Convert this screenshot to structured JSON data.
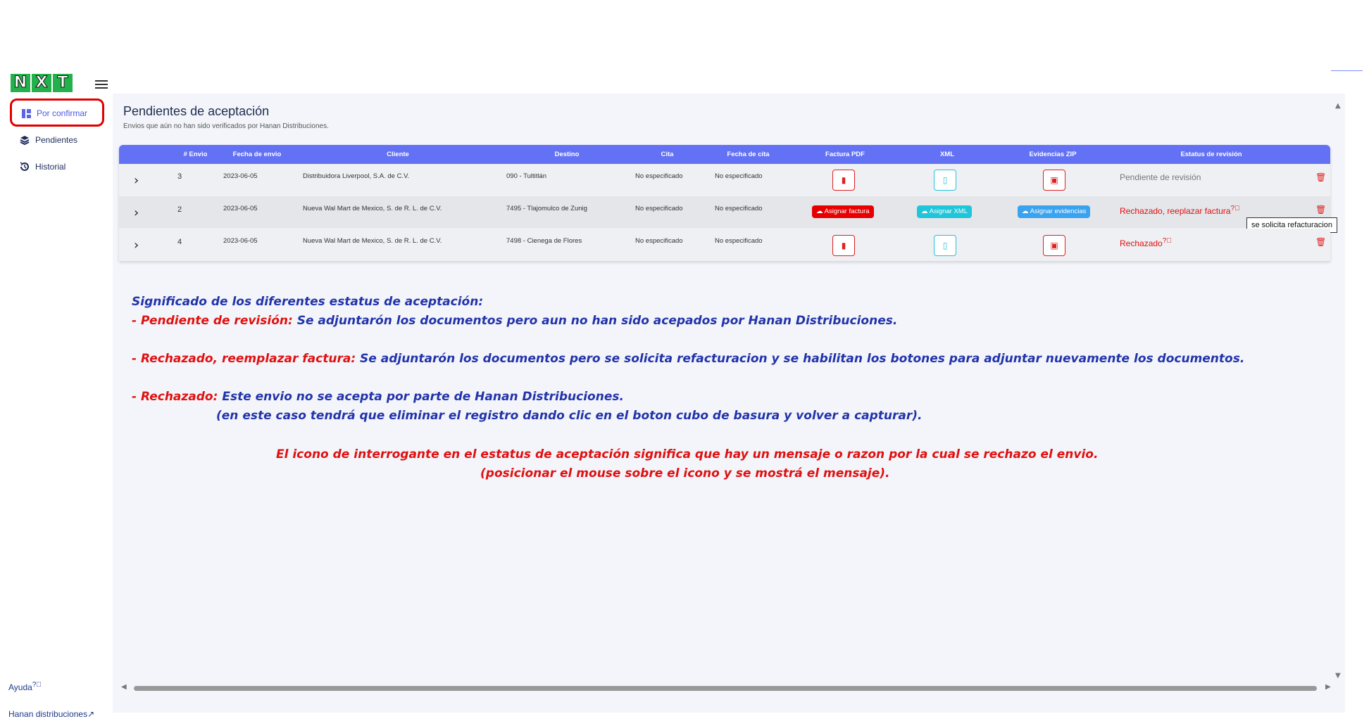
{
  "logo": {
    "letters": [
      "N",
      "X",
      "T"
    ],
    "colors": [
      "#22b14c",
      "#22b14c",
      "#22b14c"
    ]
  },
  "sidebar": {
    "items": [
      {
        "label": "Por confirmar",
        "icon": "dashboard-icon",
        "active": true
      },
      {
        "label": "Pendientes",
        "icon": "layers-icon"
      },
      {
        "label": "Historial",
        "icon": "history-icon"
      }
    ],
    "help": "Ayuda",
    "company_link": "Hanan distribuciones"
  },
  "page": {
    "title": "Pendientes de aceptación",
    "subtitle": "Envios que aún no han sido verificados por Hanan Distribuciones."
  },
  "table": {
    "headers": [
      "# Envio",
      "Fecha de envio",
      "Cliente",
      "Destino",
      "Cita",
      "Fecha de cita",
      "Factura PDF",
      "XML",
      "Evidencias ZIP",
      "Estatus de revisión"
    ],
    "rows": [
      {
        "envio": "3",
        "fecha": "2023-06-05",
        "cliente": "Distribuidora Liverpool, S.A. de C.V.",
        "destino": "090 - Tultitlán",
        "cita": "No especificado",
        "fecha_cita": "No especificado",
        "status": "Pendiente de revisión"
      },
      {
        "envio": "2",
        "fecha": "2023-06-05",
        "cliente": "Nueva Wal Mart de Mexico, S. de R. L. de C.V.",
        "destino": "7495 - Tlajomulco de Zunig",
        "cita": "No especificado",
        "fecha_cita": "No especificado",
        "status": "Rechazado, reeplazar factura",
        "btn_factura": "Asignar factura",
        "btn_xml": "Asignar XML",
        "btn_evid": "Asignar evidencias"
      },
      {
        "envio": "4",
        "fecha": "2023-06-05",
        "cliente": "Nueva Wal Mart de Mexico, S. de R. L. de C.V.",
        "destino": "7498 - Cienega de Flores",
        "cita": "No especificado",
        "fecha_cita": "No especificado",
        "status": "Rechazado"
      }
    ]
  },
  "tooltip": "se solicita refacturacion",
  "explanation": {
    "heading": "Significado de los diferentes estatus de aceptación:",
    "l1_key": "- Pendiente de revisión:",
    "l1_text": " Se adjuntarón los documentos pero aun no han sido acepados por Hanan Distribuciones.",
    "l2_key": "- Rechazado, reemplazar factura:",
    "l2_text": " Se adjuntarón los documentos pero se solicita refacturacion y se habilitan los botones para adjuntar nuevamente los documentos.",
    "l3_key": "- Rechazado:",
    "l3_text": " Este envio no se acepta por parte de Hanan Distribuciones.",
    "l3_note": "(en este caso tendrá que eliminar el registro dando clic en el boton cubo de basura y volver a capturar).",
    "footnote1": "El icono de interrogante en el estatus de aceptación significa que hay un mensaje o razon por la cual se rechazo el envio.",
    "footnote2": "(posicionar el mouse sobre el icono y se mostrá el mensaje)."
  }
}
